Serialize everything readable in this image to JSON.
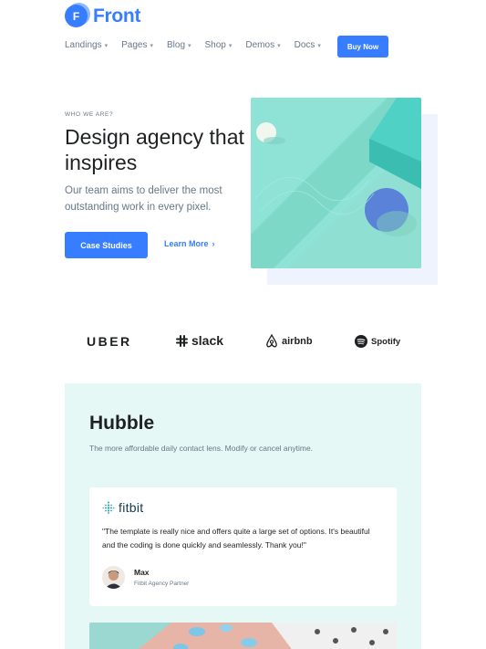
{
  "header": {
    "logo_letter": "F",
    "brand": "Front",
    "nav": [
      "Landings",
      "Pages",
      "Blog",
      "Shop",
      "Demos",
      "Docs"
    ],
    "buy_label": "Buy Now"
  },
  "hero": {
    "eyebrow": "WHO WE ARE?",
    "title": "Design agency that inspires",
    "subtitle": "Our team aims to deliver the most outstanding work in every pixel.",
    "cta_label": "Case Studies",
    "link_label": "Learn More"
  },
  "brands": {
    "uber": "UBER",
    "slack": "slack",
    "airbnb": "airbnb",
    "spotify": "Spotify"
  },
  "hubble": {
    "title": "Hubble",
    "subtitle": "The more affordable daily contact lens. Modify or cancel anytime.",
    "testimonial": {
      "logo": "fitbit",
      "quote": "\"The template is really nice and offers quite a large set of options. It's beautiful and the coding is done quickly and seamlessly. Thank you!\"",
      "author": "Max",
      "role": "Fitbit Agency Partner"
    }
  },
  "colors": {
    "accent": "#377dff",
    "hero_art_bg": "#8ee3d6",
    "hubble_bg": "#e5f8f5"
  }
}
